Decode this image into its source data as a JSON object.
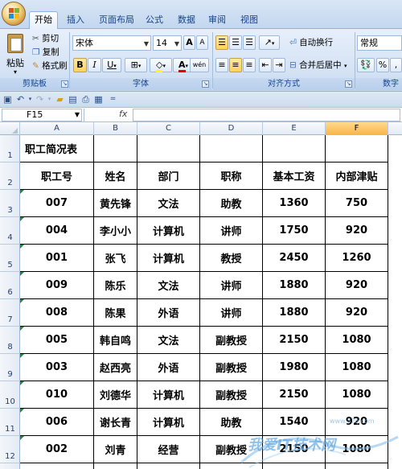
{
  "tabs": [
    {
      "label": "开始",
      "active": true
    },
    {
      "label": "插入",
      "active": false
    },
    {
      "label": "页面布局",
      "active": false
    },
    {
      "label": "公式",
      "active": false
    },
    {
      "label": "数据",
      "active": false
    },
    {
      "label": "审阅",
      "active": false
    },
    {
      "label": "视图",
      "active": false
    }
  ],
  "ribbon": {
    "clipboard": {
      "paste": "粘贴",
      "cut": "剪切",
      "copy": "复制",
      "format_painter": "格式刷",
      "group_label": "剪贴板"
    },
    "font": {
      "name": "宋体",
      "size": "14",
      "grow": "A",
      "shrink": "A",
      "bold": "B",
      "italic": "I",
      "underline": "U",
      "font_color": "A",
      "phonetic": "wén",
      "group_label": "字体"
    },
    "alignment": {
      "wrap_text": "自动换行",
      "merge_center": "合并后居中",
      "group_label": "对齐方式"
    },
    "number": {
      "format": "常规",
      "percent": "%",
      "comma": ",",
      "group_label": "数字"
    }
  },
  "qat": {
    "more": "="
  },
  "formula_bar": {
    "name_box": "F15",
    "fx": "fx",
    "value": ""
  },
  "columns": [
    "A",
    "B",
    "C",
    "D",
    "E",
    "F"
  ],
  "selected_column": "F",
  "rows": [
    "1",
    "2",
    "3",
    "4",
    "5",
    "6",
    "7",
    "8",
    "9",
    "10",
    "11",
    "12"
  ],
  "sheet": {
    "title": "职工简况表",
    "headers": [
      "职工号",
      "姓名",
      "部门",
      "职称",
      "基本工资",
      "内部津贴"
    ],
    "records": [
      [
        "007",
        "黄先锋",
        "文法",
        "助教",
        "1360",
        "750"
      ],
      [
        "004",
        "李小小",
        "计算机",
        "讲师",
        "1750",
        "920"
      ],
      [
        "001",
        "张飞",
        "计算机",
        "教授",
        "2450",
        "1260"
      ],
      [
        "009",
        "陈乐",
        "文法",
        "讲师",
        "1880",
        "920"
      ],
      [
        "008",
        "陈果",
        "外语",
        "讲师",
        "1880",
        "920"
      ],
      [
        "005",
        "韩自鸣",
        "文法",
        "副教授",
        "2150",
        "1080"
      ],
      [
        "003",
        "赵西亮",
        "外语",
        "副教授",
        "1980",
        "1080"
      ],
      [
        "010",
        "刘德华",
        "计算机",
        "副教授",
        "2150",
        "1080"
      ],
      [
        "006",
        "谢长青",
        "计算机",
        "助教",
        "1540",
        "920"
      ],
      [
        "002",
        "刘青",
        "经营",
        "副教授",
        "2150",
        "1080"
      ]
    ]
  },
  "watermark": {
    "text": "我爱IT技术网",
    "url": "www.52ij.com"
  }
}
